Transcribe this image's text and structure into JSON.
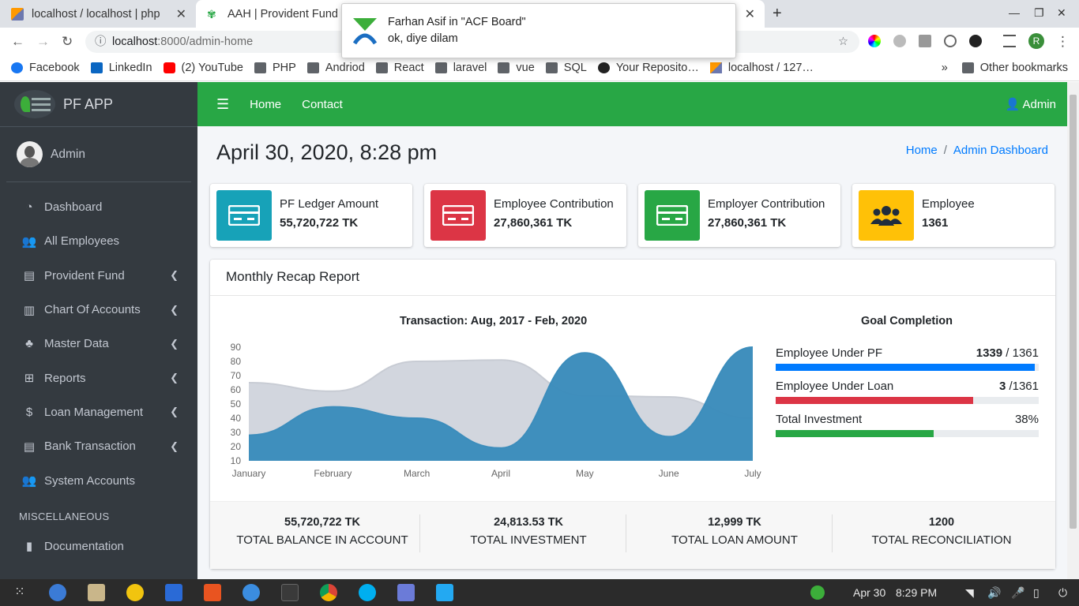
{
  "browser": {
    "tab1_title": "localhost / localhost | php",
    "tab2_title": "AAH | Provident Fund",
    "url_host": "localhost",
    "url_rest": ":8000/admin-home",
    "bookmarks": [
      "Facebook",
      "LinkedIn",
      "(2) YouTube",
      "PHP",
      "Andriod",
      "React",
      "laravel",
      "vue",
      "SQL",
      "Your Reposito…",
      "localhost / 127…"
    ],
    "more": "»",
    "other_bookmarks": "Other bookmarks",
    "profile_initial": "R"
  },
  "notification": {
    "title": "Farhan Asif in \"ACF Board\"",
    "body": "ok, diye dilam"
  },
  "sidebar": {
    "brand": "PF APP",
    "user": "Admin",
    "items": [
      {
        "label": "Dashboard",
        "icon": "tachometer-icon",
        "chevron": false
      },
      {
        "label": "All Employees",
        "icon": "users-icon",
        "chevron": false
      },
      {
        "label": "Provident Fund",
        "icon": "book-icon",
        "chevron": true
      },
      {
        "label": "Chart Of Accounts",
        "icon": "bar-chart-icon",
        "chevron": true
      },
      {
        "label": "Master Data",
        "icon": "tree-icon",
        "chevron": true
      },
      {
        "label": "Reports",
        "icon": "table-icon",
        "chevron": true
      },
      {
        "label": "Loan Management",
        "icon": "hand-money-icon",
        "chevron": true
      },
      {
        "label": "Bank Transaction",
        "icon": "book-icon",
        "chevron": true
      },
      {
        "label": "System Accounts",
        "icon": "users-icon",
        "chevron": false
      }
    ],
    "misc_header": "MISCELLANEOUS",
    "misc_items": [
      {
        "label": "Documentation",
        "icon": "file-icon"
      }
    ]
  },
  "topnav": {
    "home": "Home",
    "contact": "Contact",
    "admin": "Admin"
  },
  "page": {
    "title": "April 30, 2020, 8:28 pm",
    "breadcrumb_home": "Home",
    "breadcrumb_sep": "/",
    "breadcrumb_active": "Admin Dashboard"
  },
  "info_boxes": [
    {
      "label": "PF Ledger Amount",
      "value": "55,720,722 TK",
      "color": "#17a2b8",
      "icon": "money-bill-icon"
    },
    {
      "label": "Employee Contribution",
      "value": "27,860,361 TK",
      "color": "#dc3545",
      "icon": "money-bill-icon"
    },
    {
      "label": "Employer Contribution",
      "value": "27,860,361 TK",
      "color": "#28a745",
      "icon": "money-bill-icon"
    },
    {
      "label": "Employee",
      "value": "1361",
      "color": "#ffc107",
      "icon": "users-icon"
    }
  ],
  "recap": {
    "header": "Monthly Recap Report",
    "goal_title": "Goal Completion",
    "goals": [
      {
        "label": "Employee Under PF",
        "value_bold": "1339",
        "value_rest": " / 1361",
        "percent": 98.4,
        "color": "#007bff"
      },
      {
        "label": "Employee Under Loan",
        "value_bold": "3",
        "value_rest": " /1361",
        "percent": 75,
        "color": "#dc3545"
      },
      {
        "label": "Total Investment",
        "value_bold": "",
        "value_rest": "38%",
        "percent": 60,
        "color": "#28a745"
      }
    ],
    "stats": [
      {
        "value": "55,720,722 TK",
        "label": "TOTAL BALANCE IN ACCOUNT"
      },
      {
        "value": "24,813.53 TK",
        "label": "TOTAL INVESTMENT"
      },
      {
        "value": "12,999 TK",
        "label": "TOTAL LOAN AMOUNT"
      },
      {
        "value": "1200",
        "label": "TOTAL RECONCILIATION"
      }
    ]
  },
  "chart_data": {
    "type": "area",
    "title": "Transaction: Aug, 2017 - Feb, 2020",
    "categories": [
      "January",
      "February",
      "March",
      "April",
      "May",
      "June",
      "July"
    ],
    "ylim": [
      10,
      90
    ],
    "yticks": [
      10,
      20,
      30,
      40,
      50,
      60,
      70,
      80,
      90
    ],
    "series": [
      {
        "values": [
          65,
          59,
          80,
          81,
          56,
          55,
          40
        ],
        "color": "#d2d6de"
      },
      {
        "values": [
          28,
          48,
          40,
          19,
          86,
          27,
          90
        ],
        "color": "#3c8dbc"
      }
    ],
    "grid": false,
    "legend": "none"
  },
  "taskbar": {
    "date": "Apr 30",
    "time": "8:29 PM"
  }
}
